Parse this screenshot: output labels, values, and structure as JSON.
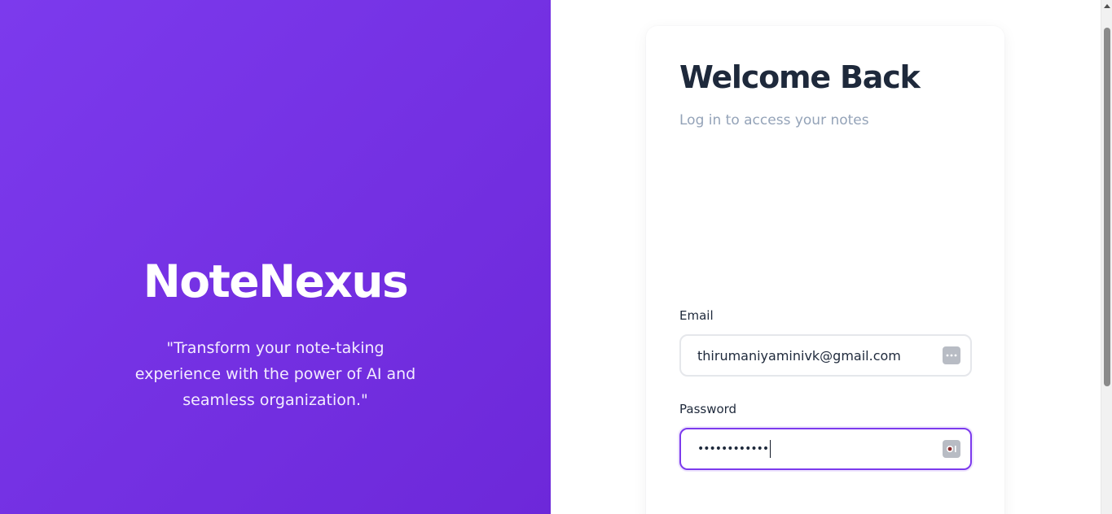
{
  "hero": {
    "brand": "NoteNexus",
    "tagline": "\"Transform your note-taking experience with the power of AI and seamless organization.\"",
    "gradient_start": "#7c3aed",
    "gradient_end": "#6d28d9"
  },
  "login": {
    "title": "Welcome Back",
    "subtitle": "Log in to access your notes",
    "email": {
      "label": "Email",
      "value": "thirumaniyaminivk@gmail.com",
      "icon": "password-manager-icon"
    },
    "password": {
      "label": "Password",
      "masked_value": "••••••••••••",
      "icon": "password-manager-key-icon",
      "focused": true
    },
    "accent": "#7c3aed"
  }
}
